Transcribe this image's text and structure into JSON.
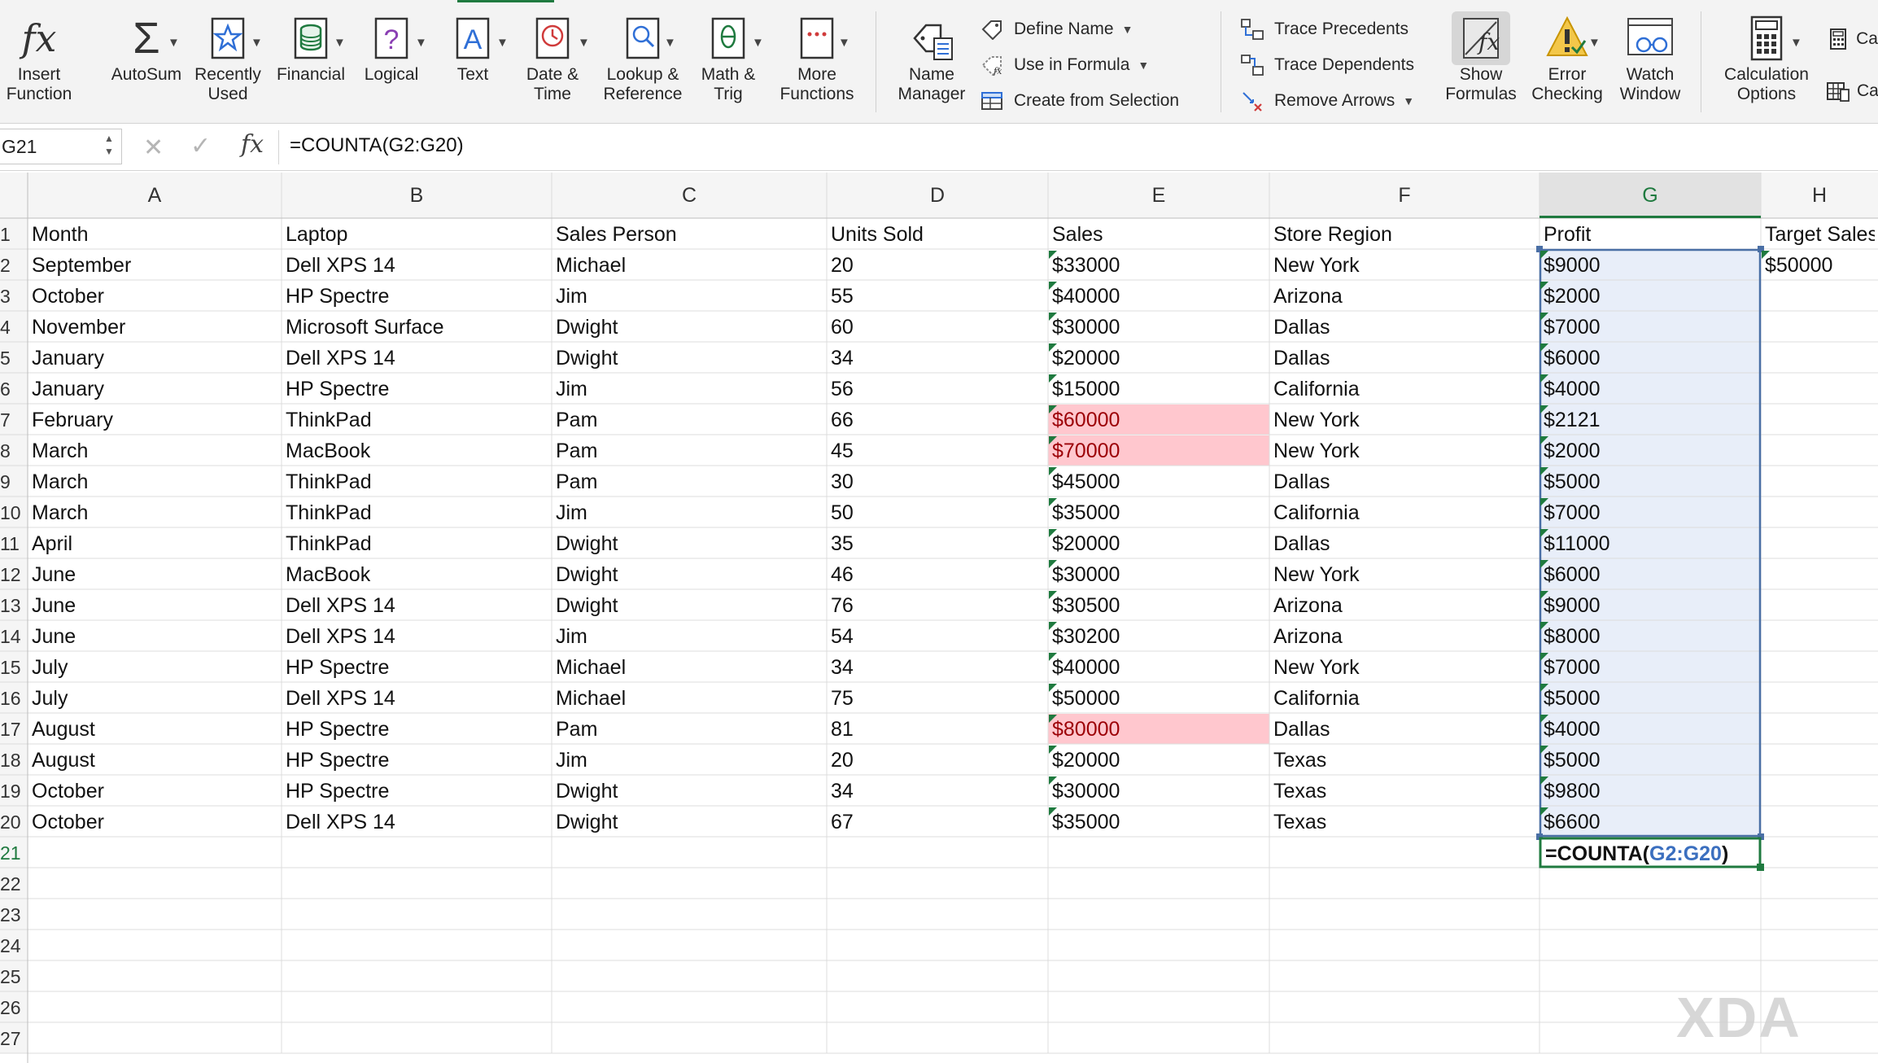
{
  "ribbon": {
    "buttons": {
      "insert_function": "Insert\nFunction",
      "autosum": "AutoSum",
      "recently_used": "Recently\nUsed",
      "financial": "Financial",
      "logical": "Logical",
      "text": "Text",
      "date_time": "Date &\nTime",
      "lookup_reference": "Lookup &\nReference",
      "math_trig": "Math &\nTrig",
      "more_functions": "More\nFunctions",
      "name_manager": "Name\nManager",
      "show_formulas": "Show\nFormulas",
      "error_checking": "Error\nChecking",
      "watch_window": "Watch\nWindow",
      "calculation_options": "Calculation\nOptions",
      "calc_now_partial": "Ca",
      "calc_sheet_partial": "Ca"
    },
    "defined_names": {
      "define_name": "Define Name",
      "use_in_formula": "Use in Formula",
      "create_from_selection": "Create from Selection"
    },
    "auditing": {
      "trace_precedents": "Trace Precedents",
      "trace_dependents": "Trace Dependents",
      "remove_arrows": "Remove Arrows"
    }
  },
  "formula_bar": {
    "name_box": "G21",
    "formula": "=COUNTA(G2:G20)"
  },
  "sheet": {
    "column_headers": [
      "A",
      "B",
      "C",
      "D",
      "E",
      "F",
      "G",
      "H"
    ],
    "row_numbers": [
      "1",
      "2",
      "3",
      "4",
      "5",
      "6",
      "7",
      "8",
      "9",
      "10",
      "11",
      "12",
      "13",
      "14",
      "15",
      "16",
      "17",
      "18",
      "19",
      "20",
      "21",
      "22",
      "23",
      "24",
      "25",
      "26",
      "27"
    ],
    "header_row": [
      "Month",
      "Laptop",
      "Sales Person",
      "Units Sold",
      "Sales",
      "Store Region",
      "Profit",
      "Target Sales"
    ],
    "rows": [
      [
        "September",
        "Dell XPS 14",
        "Michael",
        "20",
        "$33000",
        "New York",
        "$9000",
        "$50000"
      ],
      [
        "October",
        "HP Spectre",
        "Jim",
        "55",
        "$40000",
        "Arizona",
        "$2000",
        ""
      ],
      [
        "November",
        "Microsoft Surface",
        "Dwight",
        "60",
        "$30000",
        "Dallas",
        "$7000",
        ""
      ],
      [
        "January",
        "Dell XPS 14",
        "Dwight",
        "34",
        "$20000",
        "Dallas",
        "$6000",
        ""
      ],
      [
        "January",
        "HP Spectre",
        "Jim",
        "56",
        "$15000",
        "California",
        "$4000",
        ""
      ],
      [
        "February",
        "ThinkPad",
        "Pam",
        "66",
        "$60000",
        "New York",
        "$2121",
        ""
      ],
      [
        "March",
        "MacBook",
        "Pam",
        "45",
        "$70000",
        "New York",
        "$2000",
        ""
      ],
      [
        "March",
        "ThinkPad",
        "Pam",
        "30",
        "$45000",
        "Dallas",
        "$5000",
        ""
      ],
      [
        "March",
        "ThinkPad",
        "Jim",
        "50",
        "$35000",
        "California",
        "$7000",
        ""
      ],
      [
        "April",
        "ThinkPad",
        "Dwight",
        "35",
        "$20000",
        "Dallas",
        "$11000",
        ""
      ],
      [
        "June",
        "MacBook",
        "Dwight",
        "46",
        "$30000",
        "New York",
        "$6000",
        ""
      ],
      [
        "June",
        "Dell XPS 14",
        "Dwight",
        "76",
        "$30500",
        "Arizona",
        "$9000",
        ""
      ],
      [
        "June",
        "Dell XPS 14",
        "Jim",
        "54",
        "$30200",
        "Arizona",
        "$8000",
        ""
      ],
      [
        "July",
        "HP Spectre",
        "Michael",
        "34",
        "$40000",
        "New York",
        "$7000",
        ""
      ],
      [
        "July",
        "Dell XPS 14",
        "Michael",
        "75",
        "$50000",
        "California",
        "$5000",
        ""
      ],
      [
        "August",
        "HP Spectre",
        "Pam",
        "81",
        "$80000",
        "Dallas",
        "$4000",
        ""
      ],
      [
        "August",
        "HP Spectre",
        "Jim",
        "20",
        "$20000",
        "Texas",
        "$5000",
        ""
      ],
      [
        "October",
        "HP Spectre",
        "Dwight",
        "34",
        "$30000",
        "Texas",
        "$9800",
        ""
      ],
      [
        "October",
        "Dell XPS 14",
        "Dwight",
        "67",
        "$35000",
        "Texas",
        "$6600",
        ""
      ]
    ],
    "highlighted_sales_rows": [
      6,
      7,
      16
    ],
    "editing_cell": {
      "prefix": "=COUNTA(",
      "ref": "G2:G20",
      "suffix": ")"
    },
    "colors": {
      "highlight_fill": "#ffc7ce",
      "highlight_text": "#9c0006",
      "range_fill": "#e8eef9",
      "range_border": "#4a6fa5",
      "active_green": "#1f7a3f",
      "ref_blue": "#3b6fbf"
    }
  },
  "watermark": {
    "text": "XDA"
  }
}
